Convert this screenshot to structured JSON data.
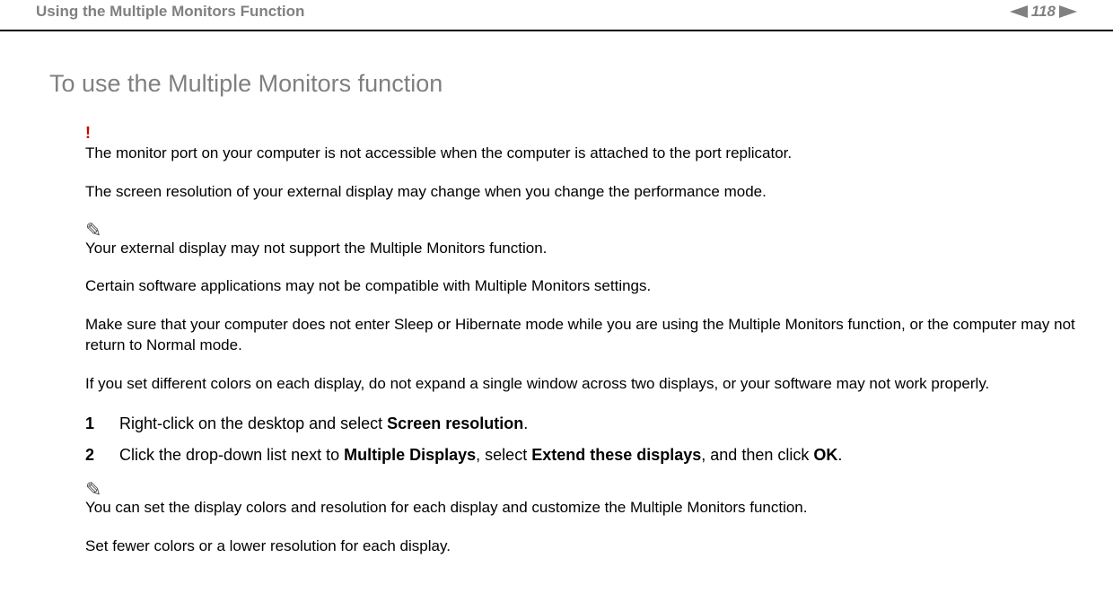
{
  "header": {
    "title": "Using the Multiple Monitors Function",
    "page_number": "118"
  },
  "main": {
    "heading": "To use the Multiple Monitors function",
    "warn_mark": "!",
    "warn_p1": "The monitor port on your computer is not accessible when the computer is attached to the port replicator.",
    "warn_p2": "The screen resolution of your external display may change when you change the performance mode.",
    "note1_mark": "✎",
    "note1_p1": "Your external display may not support the Multiple Monitors function.",
    "note1_p2": "Certain software applications may not be compatible with Multiple Monitors settings.",
    "note1_p3": "Make sure that your computer does not enter Sleep or Hibernate mode while you are using the Multiple Monitors function, or the computer may not return to Normal mode.",
    "note1_p4": "If you set different colors on each display, do not expand a single window across two displays, or your software may not work properly.",
    "steps": [
      {
        "num": "1",
        "pre": "Right-click on the desktop and select ",
        "b1": "Screen resolution",
        "post": "."
      },
      {
        "num": "2",
        "pre": "Click the drop-down list next to ",
        "b1": "Multiple Displays",
        "mid1": ", select ",
        "b2": "Extend these displays",
        "mid2": ", and then click ",
        "b3": "OK",
        "post": "."
      }
    ],
    "note2_mark": "✎",
    "note2_p1": "You can set the display colors and resolution for each display and customize the Multiple Monitors function.",
    "note2_p2": "Set fewer colors or a lower resolution for each display."
  }
}
